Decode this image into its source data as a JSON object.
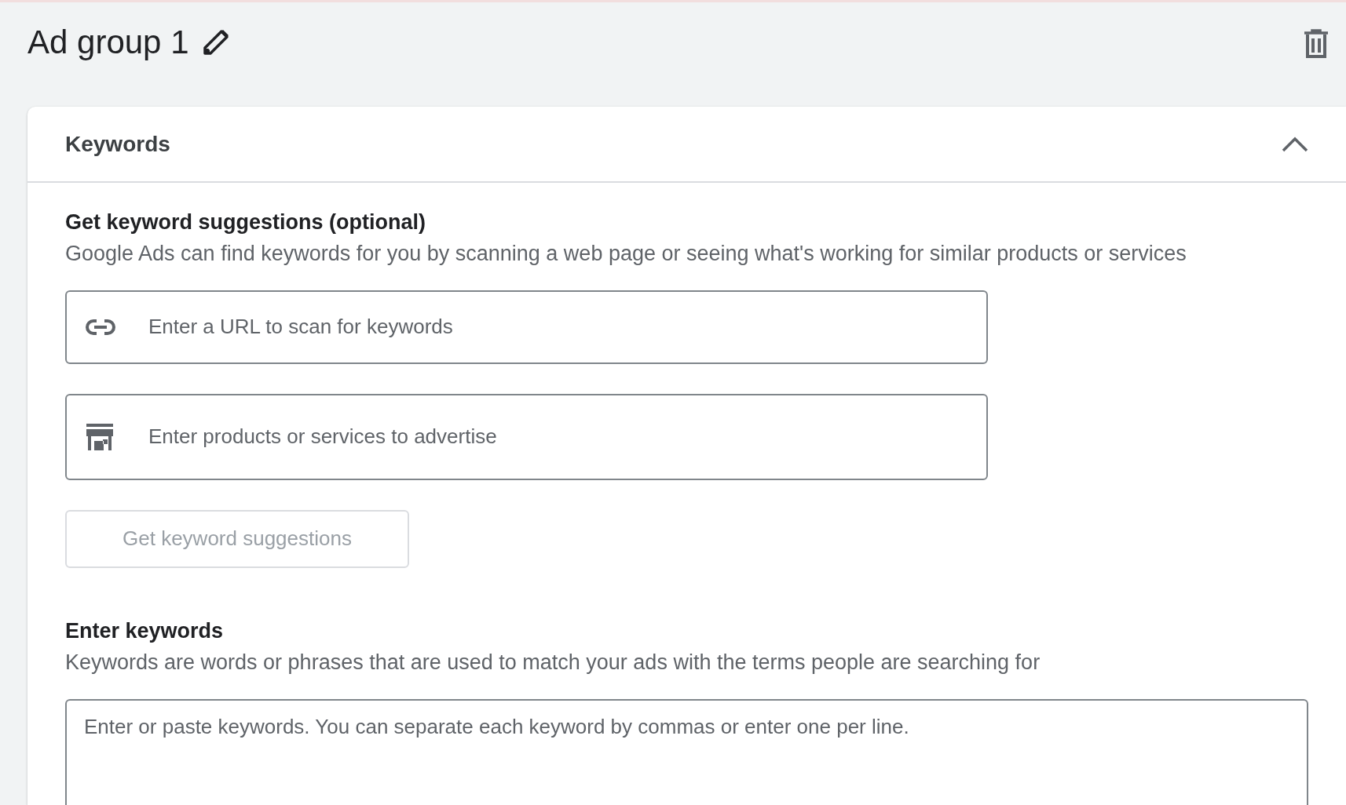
{
  "header": {
    "title": "Ad group 1"
  },
  "keywords_panel": {
    "title": "Keywords",
    "expanded": true,
    "suggestions": {
      "title": "Get keyword suggestions (optional)",
      "description": "Google Ads can find keywords for you by scanning a web page or seeing what's working for similar products or services",
      "fields": [
        {
          "kind": "url",
          "placeholder": "Enter a URL to scan for keywords"
        },
        {
          "kind": "products",
          "placeholder": "Enter products or services to advertise"
        }
      ],
      "button": {
        "label": "Get keyword suggestions",
        "disabled": true
      }
    },
    "keywords": {
      "title": "Enter keywords",
      "description": "Keywords are words or phrases that are used to match your ads with the terms people are searching for",
      "placeholder": "Enter or paste keywords. You can separate each keyword by commas or enter one per line."
    }
  }
}
